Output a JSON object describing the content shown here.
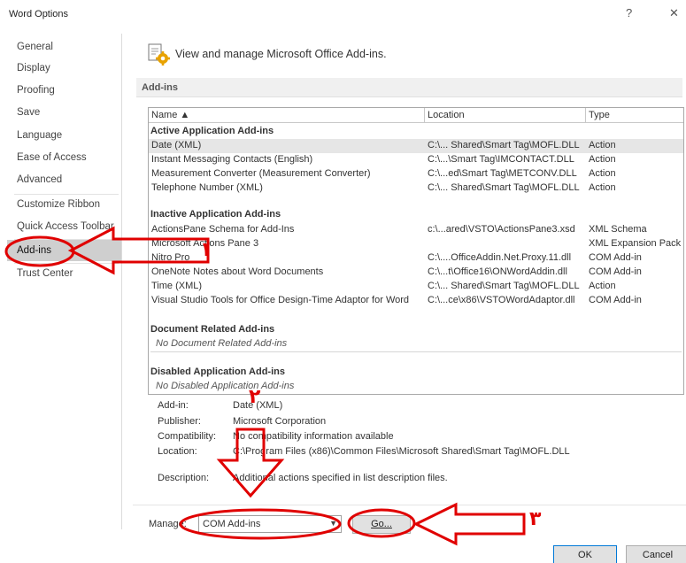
{
  "window": {
    "title": "Word Options",
    "help_glyph": "?",
    "close_glyph": "✕"
  },
  "sidebar": {
    "items": [
      {
        "label": "General"
      },
      {
        "label": "Display"
      },
      {
        "label": "Proofing"
      },
      {
        "label": "Save"
      },
      {
        "label": "Language"
      },
      {
        "label": "Ease of Access"
      },
      {
        "label": "Advanced"
      },
      {
        "label": "Customize Ribbon"
      },
      {
        "label": "Quick Access Toolbar"
      },
      {
        "label": "Add-ins",
        "selected": true
      },
      {
        "label": "Trust Center"
      }
    ]
  },
  "main": {
    "header_text": "View and manage Microsoft Office Add-ins.",
    "section_label": "Add-ins",
    "table": {
      "columns": [
        "Name ▲",
        "Location",
        "Type"
      ],
      "groups": [
        {
          "title": "Active Application Add-ins",
          "rows": [
            {
              "name": "Date (XML)",
              "location": "C:\\... Shared\\Smart Tag\\MOFL.DLL",
              "type": "Action",
              "selected": true
            },
            {
              "name": "Instant Messaging Contacts (English)",
              "location": "C:\\...\\Smart Tag\\IMCONTACT.DLL",
              "type": "Action"
            },
            {
              "name": "Measurement Converter (Measurement Converter)",
              "location": "C:\\...ed\\Smart Tag\\METCONV.DLL",
              "type": "Action"
            },
            {
              "name": "Telephone Number (XML)",
              "location": "C:\\... Shared\\Smart Tag\\MOFL.DLL",
              "type": "Action"
            }
          ]
        },
        {
          "title": "Inactive Application Add-ins",
          "rows": [
            {
              "name": "ActionsPane Schema for Add-Ins",
              "location": "c:\\...ared\\VSTO\\ActionsPane3.xsd",
              "type": "XML Schema"
            },
            {
              "name": "Microsoft Actions Pane 3",
              "location": "",
              "type": "XML Expansion Pack"
            },
            {
              "name": "Nitro Pro",
              "location": "C:\\....OfficeAddin.Net.Proxy.11.dll",
              "type": "COM Add-in"
            },
            {
              "name": "OneNote Notes about Word Documents",
              "location": "C:\\...t\\Office16\\ONWordAddin.dll",
              "type": "COM Add-in"
            },
            {
              "name": "Time (XML)",
              "location": "C:\\... Shared\\Smart Tag\\MOFL.DLL",
              "type": "Action"
            },
            {
              "name": "Visual Studio Tools for Office Design-Time Adaptor for Word",
              "location": "C:\\...ce\\x86\\VSTOWordAdaptor.dll",
              "type": "COM Add-in"
            }
          ]
        },
        {
          "title": "Document Related Add-ins",
          "empty_note": "No Document Related Add-ins"
        },
        {
          "title": "Disabled Application Add-ins",
          "empty_note": "No Disabled Application Add-ins"
        }
      ]
    },
    "details": {
      "addin_label": "Add-in:",
      "addin_value": "Date (XML)",
      "publisher_label": "Publisher:",
      "publisher_value": "Microsoft Corporation",
      "compat_label": "Compatibility:",
      "compat_value": "No compatibility information available",
      "location_label": "Location:",
      "location_value": "C:\\Program Files (x86)\\Common Files\\Microsoft Shared\\Smart Tag\\MOFL.DLL",
      "description_label": "Description:",
      "description_value": "Additional actions specified in list description files."
    },
    "manage": {
      "label": "Manage:",
      "selected": "COM Add-ins",
      "go_label": "Go..."
    }
  },
  "footer": {
    "ok_label": "OK",
    "cancel_label": "Cancel"
  },
  "annotations": {
    "color": "#e00000",
    "numbers": [
      "١",
      "٢",
      "٣"
    ]
  }
}
